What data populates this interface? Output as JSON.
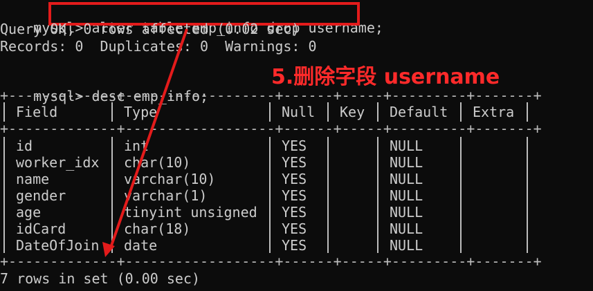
{
  "terminal": {
    "prompt": "mysql>",
    "command": " alter table emp_info drop username;",
    "result_line1": "Query OK, 0 rows affected (0.02 sec)",
    "result_line2": "Records: 0  Duplicates: 0  Warnings: 0",
    "desc_command": " desc emp_info;",
    "border_top": "+-------------+------------------+------+-----+---------+-------+",
    "border_mid": "+-------------+------------------+------+-----+---------+-------+",
    "border_bottom": "+-------------+------------------+------+-----+---------+-------+",
    "footer": "7 rows in set (0.00 sec)"
  },
  "annotation": {
    "text": "5.删除字段 username",
    "color": "#ff2a2a"
  },
  "table": {
    "headers": [
      "Field",
      "Type",
      "Null",
      "Key",
      "Default",
      "Extra"
    ],
    "rows": [
      [
        "id",
        "int",
        "YES",
        "",
        "NULL",
        ""
      ],
      [
        "worker_idx",
        "char(10)",
        "YES",
        "",
        "NULL",
        ""
      ],
      [
        "name",
        "varchar(10)",
        "YES",
        "",
        "NULL",
        ""
      ],
      [
        "gender",
        "varchar(1)",
        "YES",
        "",
        "NULL",
        ""
      ],
      [
        "age",
        "tinyint unsigned",
        "YES",
        "",
        "NULL",
        ""
      ],
      [
        "idCard",
        "char(18)",
        "YES",
        "",
        "NULL",
        ""
      ],
      [
        "DateOfJoin",
        "date",
        "YES",
        "",
        "NULL",
        ""
      ]
    ]
  },
  "colors": {
    "background": "#0c0c0c",
    "text": "#cccccc",
    "highlight": "#e31b1b"
  }
}
